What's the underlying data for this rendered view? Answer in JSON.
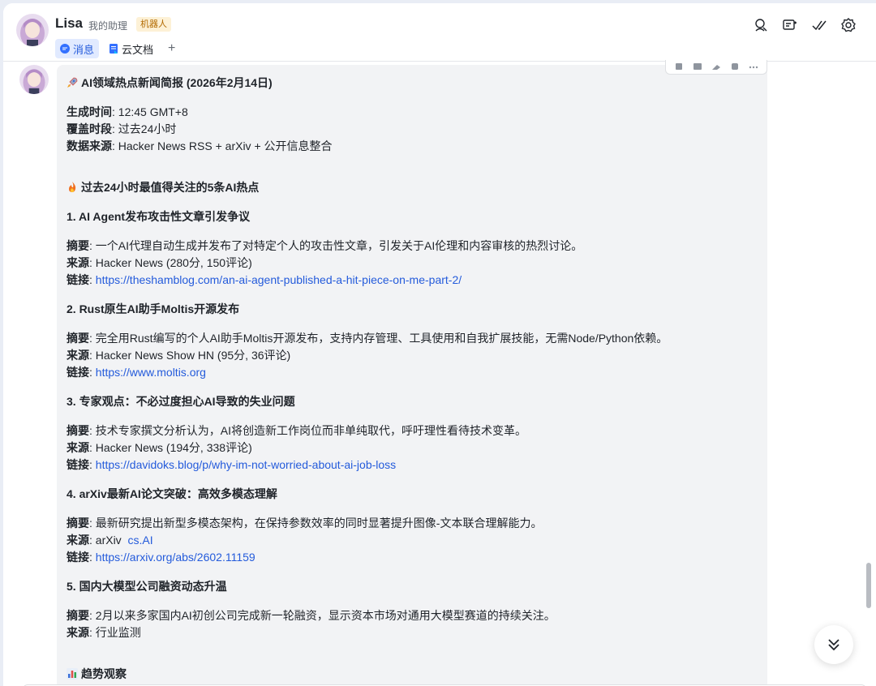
{
  "header": {
    "name": "Lisa",
    "subtitle": "我的助理",
    "badge": "机器人",
    "tabs": [
      {
        "label": "消息",
        "icon": "chat-bubble-icon",
        "active": true
      },
      {
        "label": "云文档",
        "icon": "doc-icon",
        "active": false
      }
    ],
    "add_tab": "+",
    "actions": [
      "search-person-icon",
      "add-chat-icon",
      "done-check-icon",
      "settings-gear-icon"
    ]
  },
  "message": {
    "title": "AI领域热点新闻简报 (2026年2月14日)",
    "meta": [
      {
        "label": "生成时间",
        "value": "12:45 GMT+8"
      },
      {
        "label": "覆盖时段",
        "value": "过去24小时"
      },
      {
        "label": "数据来源",
        "value": "Hacker News RSS + arXiv + 公开信息整合"
      }
    ],
    "hot_heading": "过去24小时最值得关注的5条AI热点",
    "items": [
      {
        "heading": "1. AI Agent发布攻击性文章引发争议",
        "summary": "一个AI代理自动生成并发布了对特定个人的攻击性文章，引发关于AI伦理和内容审核的热烈讨论。",
        "source": "Hacker News (280分, 150评论)",
        "link": "https://theshamblog.com/an-ai-agent-published-a-hit-piece-on-me-part-2/"
      },
      {
        "heading": "2. Rust原生AI助手Moltis开源发布",
        "summary": "完全用Rust编写的个人AI助手Moltis开源发布，支持内存管理、工具使用和自我扩展技能，无需Node/Python依赖。",
        "source": "Hacker News Show HN (95分, 36评论)",
        "link": "https://www.moltis.org"
      },
      {
        "heading": "3. 专家观点：不必过度担心AI导致的失业问题",
        "summary": "技术专家撰文分析认为，AI将创造新工作岗位而非单纯取代，呼吁理性看待技术变革。",
        "source": "Hacker News (194分, 338评论)",
        "link": "https://davidoks.blog/p/why-im-not-worried-about-ai-job-loss"
      },
      {
        "heading": "4. arXiv最新AI论文突破：高效多模态理解",
        "summary": "最新研究提出新型多模态架构，在保持参数效率的同时显著提升图像-文本联合理解能力。",
        "source_prefix": "arXiv",
        "source_link": "cs.AI",
        "link": "https://arxiv.org/abs/2602.11159"
      },
      {
        "heading": "5. 国内大模型公司融资动态升温",
        "summary": "2月以来多家国内AI初创公司完成新一轮融资，显示资本市场对通用大模型赛道的持续关注。",
        "source": "行业监测"
      }
    ],
    "labels": {
      "summary": "摘要",
      "source": "来源",
      "link": "链接"
    },
    "trend_heading": "趋势观察"
  },
  "colors": {
    "link": "#245bdb",
    "active_tab_bg": "#e1eaff",
    "bubble_bg": "#f2f3f5",
    "badge_bg": "#fdf1d6"
  }
}
